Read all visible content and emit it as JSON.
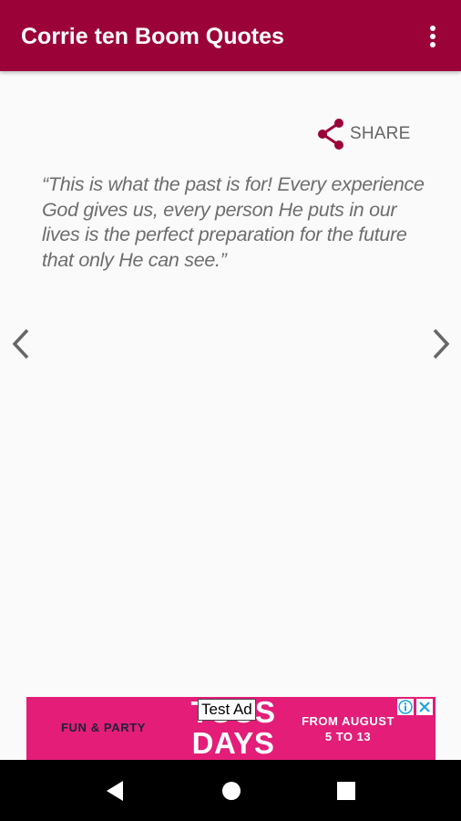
{
  "app_bar": {
    "title": "Corrie ten Boom Quotes",
    "overflow_icon": "more-vert-icon",
    "color": "#9b0338"
  },
  "share": {
    "label": "SHARE",
    "icon": "share-icon",
    "icon_color": "#9b0338"
  },
  "quote": {
    "text": "“This is what the past is for! Every experience God gives us, every person He puts in our lives is the perfect preparation for the future that only He can see.”"
  },
  "navigation": {
    "prev_icon": "chevron-left-icon",
    "next_icon": "chevron-right-icon"
  },
  "ad": {
    "label": "Test Ad",
    "left_text": "FUN & PARTY",
    "big_text_line1": "TOUS",
    "big_text_line2": "DAYS",
    "right_text_line1": "FROM AUGUST",
    "right_text_line2": "5 TO 13",
    "background": "#e31d78",
    "info_icon": "info-icon",
    "close_icon": "close-icon"
  },
  "system_nav": {
    "back_icon": "back-triangle-icon",
    "home_icon": "home-circle-icon",
    "recent_icon": "recents-square-icon"
  }
}
